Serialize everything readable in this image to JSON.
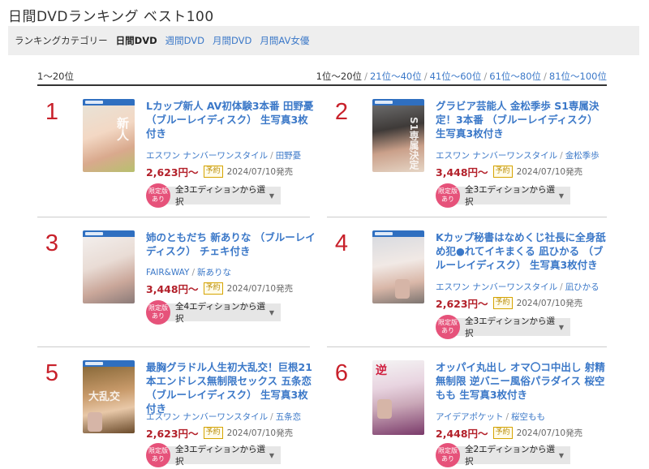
{
  "page": {
    "title": "日間DVDランキング ベスト100"
  },
  "category_bar": {
    "label": "ランキングカテゴリー",
    "active": "日間DVD",
    "links": [
      "週間DVD",
      "月間DVD",
      "月間AV女優"
    ]
  },
  "range": {
    "current": "1〜20位",
    "pages": [
      {
        "label": "1位〜20位",
        "current": true
      },
      {
        "label": "21位〜40位",
        "current": false
      },
      {
        "label": "41位〜60位",
        "current": false
      },
      {
        "label": "61位〜80位",
        "current": false
      },
      {
        "label": "81位〜100位",
        "current": false
      }
    ],
    "separator": "/"
  },
  "common": {
    "yoyaku": "予約",
    "badge_line1": "限定版",
    "badge_line2": "あり",
    "maker_sep": "/"
  },
  "colors": {
    "rank": "#c8212b",
    "link": "#3b78c8",
    "price": "#b3202a",
    "badge": "#e6527a"
  },
  "items": [
    {
      "rank": "1",
      "title": "Lカップ新人 AV初体験3本番 田野憂（ブルーレイディスク） 生写真3枚付き",
      "maker": "エスワン ナンバーワンスタイル",
      "actress": "田野憂",
      "price": "2,623円〜",
      "date": "2024/07/10発売",
      "edition": "全3エディションから選択",
      "cover_text": "新人"
    },
    {
      "rank": "2",
      "title": "グラビア芸能人 金松季歩 S1専属決定！3本番 （ブルーレイディスク） 生写真3枚付き",
      "maker": "エスワン ナンバーワンスタイル",
      "actress": "金松季歩",
      "price": "3,448円〜",
      "date": "2024/07/10発売",
      "edition": "全3エディションから選択",
      "cover_text": "S1専属決定"
    },
    {
      "rank": "3",
      "title": "姉のともだち 新ありな （ブルーレイディスク） チェキ付き",
      "maker": "FAIR&WAY",
      "actress": "新ありな",
      "price": "3,448円〜",
      "date": "2024/07/10発売",
      "edition": "全4エディションから選択",
      "cover_text": ""
    },
    {
      "rank": "4",
      "title": "Kカップ秘書はなめくじ社長に全身舐め犯●れてイキまくる 凪ひかる （ブルーレイディスク） 生写真3枚付き",
      "maker": "エスワン ナンバーワンスタイル",
      "actress": "凪ひかる",
      "price": "2,623円〜",
      "date": "2024/07/10発売",
      "edition": "全3エディションから選択",
      "cover_text": ""
    },
    {
      "rank": "5",
      "title": "最胸グラドル人生初大乱交！巨根21本エンドレス無制限セックス 五条恋 （ブルーレイディスク） 生写真3枚付き",
      "maker": "エスワン ナンバーワンスタイル",
      "actress": "五条恋",
      "price": "2,623円〜",
      "date": "2024/07/10発売",
      "edition": "全3エディションから選択",
      "cover_text": "大乱交"
    },
    {
      "rank": "6",
      "title": "オッパイ丸出し オマ〇コ中出し 射精無制限 逆バニー風俗パラダイス 桜空もも 生写真3枚付き",
      "maker": "アイデアポケット",
      "actress": "桜空もも",
      "price": "2,448円〜",
      "date": "2024/07/10発売",
      "edition": "全2エディションから選択",
      "cover_text": "逆"
    }
  ]
}
